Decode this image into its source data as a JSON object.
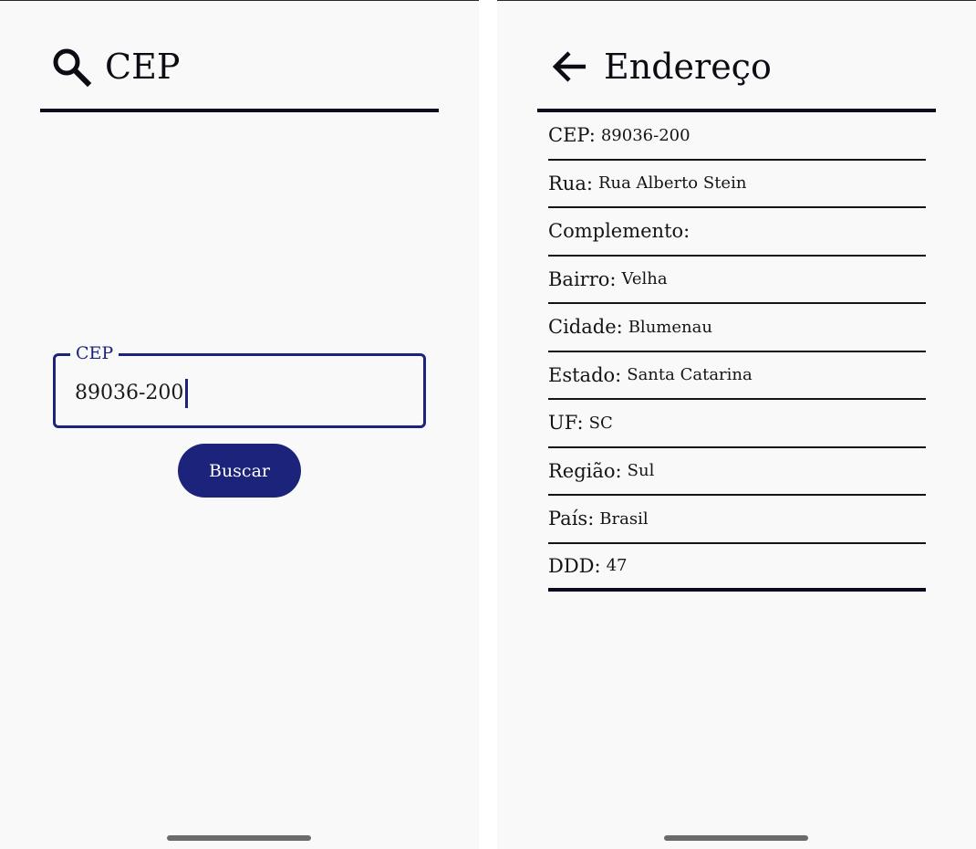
{
  "search_screen": {
    "title": "CEP",
    "header_icon": "search-icon",
    "field": {
      "label": "CEP",
      "value": "89036-200"
    },
    "button_label": "Buscar"
  },
  "address_screen": {
    "title": "Endereço",
    "header_icon": "arrow-left-icon",
    "rows": [
      {
        "label": "CEP:",
        "value": "89036-200"
      },
      {
        "label": "Rua:",
        "value": "Rua Alberto Stein"
      },
      {
        "label": "Complemento:",
        "value": ""
      },
      {
        "label": "Bairro:",
        "value": "Velha"
      },
      {
        "label": "Cidade:",
        "value": "Blumenau"
      },
      {
        "label": "Estado:",
        "value": "Santa Catarina"
      },
      {
        "label": "UF:",
        "value": "SC"
      },
      {
        "label": "Região:",
        "value": "Sul"
      },
      {
        "label": "País:",
        "value": "Brasil"
      },
      {
        "label": "DDD:",
        "value": "47"
      }
    ]
  },
  "colors": {
    "primary": "#1c237a",
    "header_rule": "#110a1f",
    "background": "#f9f9f9"
  }
}
